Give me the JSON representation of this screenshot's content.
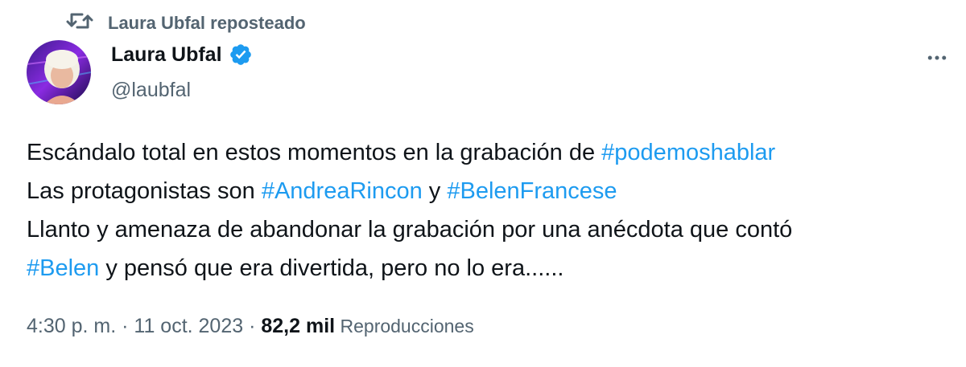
{
  "repost_text": "Laura Ubfal reposteado",
  "author": {
    "name": "Laura Ubfal",
    "handle": "@laubfal",
    "verified": true
  },
  "tweet": {
    "line1": {
      "text": "Escándalo total en estos momentos en la grabación de ",
      "tag": "#podemoshablar"
    },
    "line2": {
      "text": "Las protagonistas son ",
      "tag1": "#AndreaRincon",
      "mid": " y ",
      "tag2": "#BelenFrancese"
    },
    "line3": {
      "text": "Llanto y amenaza de abandonar la grabación por una anécdota que contó"
    },
    "line4": {
      "tag": "#Belen",
      "text": " y pensó que era divertida, pero no lo era......"
    }
  },
  "meta": {
    "time": "4:30 p. m.",
    "sep1": " · ",
    "date": "11 oct. 2023",
    "sep2": " · ",
    "views": "82,2 mil",
    "views_label": " Reproducciones"
  },
  "icons": {
    "repost": "repost-icon",
    "verified": "verified-badge-icon",
    "more": "more-options-icon"
  },
  "colors": {
    "link": "#1d9bf0",
    "secondary": "#536471",
    "primary": "#0f1419"
  }
}
